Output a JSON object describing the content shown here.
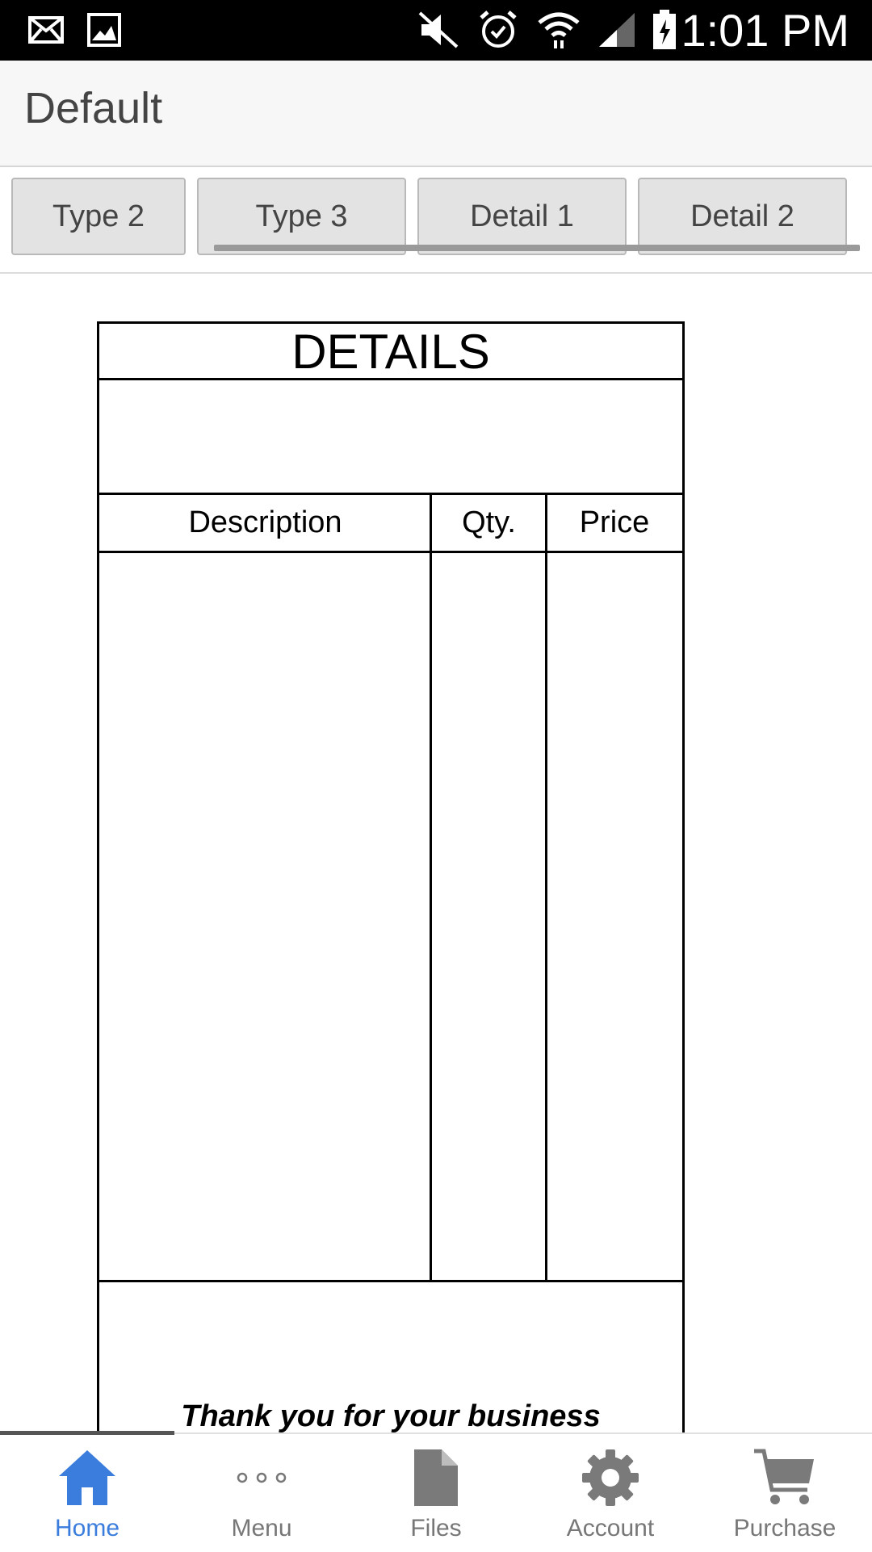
{
  "status_bar": {
    "time": "1:01 PM",
    "icons": [
      "mail-icon",
      "image-icon",
      "mute-icon",
      "alarm-icon",
      "wifi-icon",
      "signal-icon",
      "battery-icon"
    ]
  },
  "app_bar": {
    "title": "Default"
  },
  "tabs": [
    {
      "label": "Type 2"
    },
    {
      "label": "Type 3"
    },
    {
      "label": "Detail 1"
    },
    {
      "label": "Detail 2"
    }
  ],
  "document": {
    "title": "DETAILS",
    "columns": [
      "Description",
      "Qty.",
      "Price"
    ],
    "footer_text": "Thank you for your business"
  },
  "bottom_nav": {
    "active_index": 0,
    "active_color": "#3b7ddd",
    "items": [
      {
        "label": "Home",
        "icon": "home-icon"
      },
      {
        "label": "Menu",
        "icon": "more-icon"
      },
      {
        "label": "Files",
        "icon": "file-icon"
      },
      {
        "label": "Account",
        "icon": "gear-icon"
      },
      {
        "label": "Purchase",
        "icon": "cart-icon"
      }
    ]
  }
}
